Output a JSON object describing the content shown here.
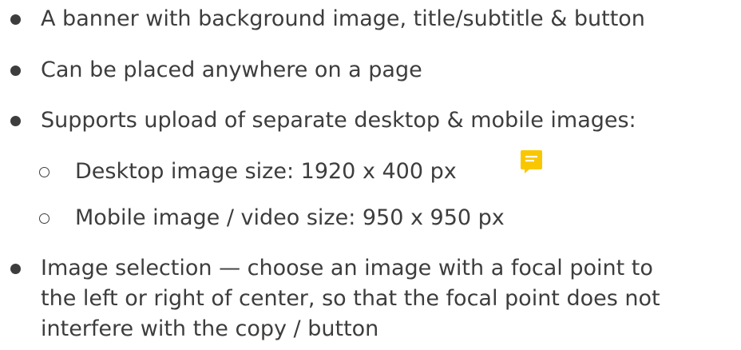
{
  "items": [
    {
      "text": "A banner with background image, title/subtitle & button",
      "level": 1
    },
    {
      "text": "Can be placed anywhere on a page",
      "level": 1
    },
    {
      "text": "Supports upload of separate desktop & mobile images:",
      "level": 1
    },
    {
      "text": "Desktop image size: 1920 x 400 px",
      "level": 2
    },
    {
      "text": "Mobile image / video size: 950 x 950 px",
      "level": 2
    },
    {
      "level": 1,
      "lines": [
        "Image selection — choose an image with a focal point to",
        "the left or right of center, so that the focal point does not",
        "interfere with the copy / button"
      ]
    }
  ],
  "icons": {
    "comment": "comment-icon"
  },
  "colors": {
    "text": "#3d3d3d",
    "comment_icon": "#f9c700"
  }
}
